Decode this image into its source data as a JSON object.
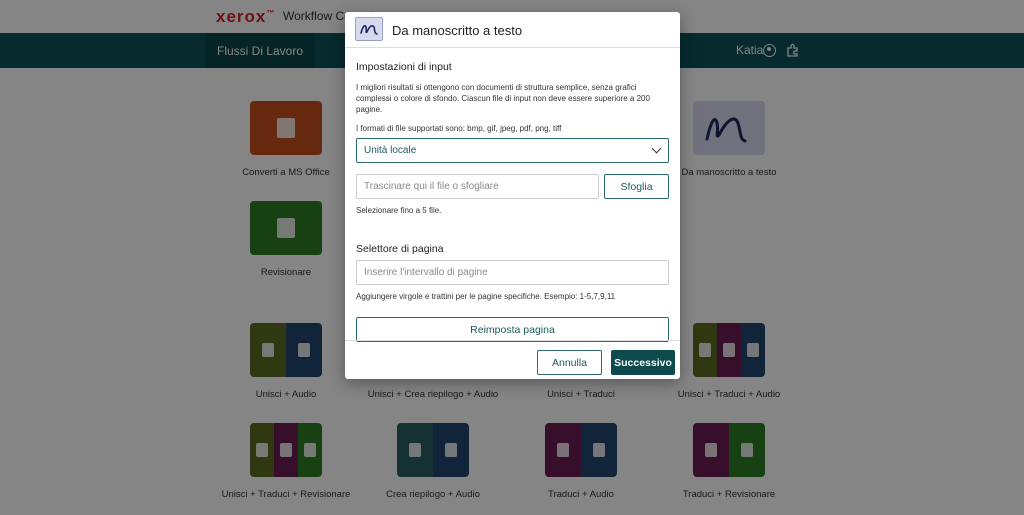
{
  "header": {
    "logo": "xerox",
    "logo_mark": "™",
    "app_title": "Workflow Central"
  },
  "nav": {
    "active_tab": "Flussi Di Lavoro",
    "user_name": "Katia"
  },
  "icons": {
    "user": "user-circle-icon",
    "apps": "puzzle-icon"
  },
  "colors": {
    "nav_bg": "#0c5257",
    "brand_red": "#d42020",
    "primary_button": "#0c4a4e"
  },
  "tiles": [
    {
      "label": "Converti a MS Office"
    },
    {
      "label": "Da manoscritto a testo"
    },
    {
      "label": "Revisionare"
    },
    {
      "label": "Unisci + Audio"
    },
    {
      "label": "Unisci + Crea riepilogo + Audio"
    },
    {
      "label": "Unisci + Traduci"
    },
    {
      "label": "Unisci + Traduci + Audio"
    },
    {
      "label": "Unisci + Traduci + Revisionare"
    },
    {
      "label": "Crea riepilogo + Audio"
    },
    {
      "label": "Traduci + Audio"
    },
    {
      "label": "Traduci + Revisionare"
    }
  ],
  "dialog": {
    "title": "Da manoscritto a testo",
    "input_section": "Impostazioni di input",
    "description": "I migliori risultati si ottengono con documenti di struttura semplice, senza grafici complessi o colore di sfondo. Ciascun file di input non deve essere superiore a 200 pagine.",
    "formats": "I formati di file supportati sono: bmp, gif, jpeg, pdf, png, tiff",
    "source_select": "Unità locale",
    "file_placeholder": "Trascinare qui il file o sfogliare",
    "browse_button": "Sfoglia",
    "file_hint": "Selezionare fino a 5 file.",
    "page_section": "Selettore di pagina",
    "page_placeholder": "Inserire l'intervallo di pagine",
    "page_hint": "Aggiungere virgole e trattini per le pagine specifiche. Esempio: 1-5,7,9,11",
    "reset_button": "Reimposta pagina",
    "cancel_button": "Annulla",
    "next_button": "Successivo"
  }
}
